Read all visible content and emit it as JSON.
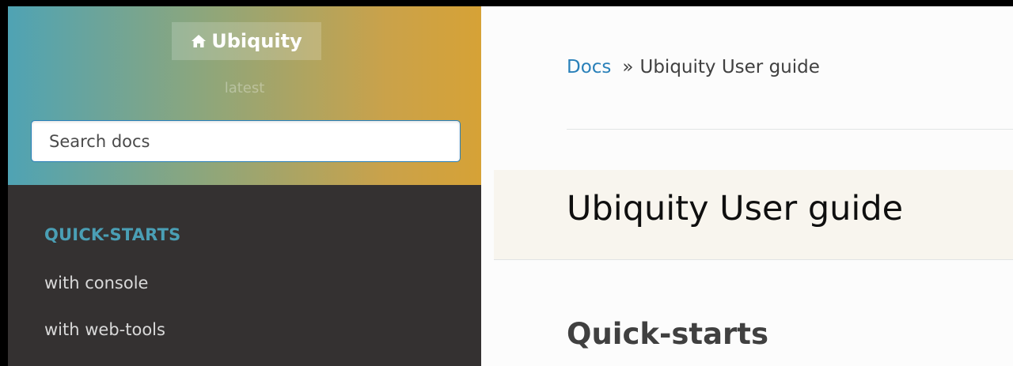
{
  "sidebar": {
    "brand": "Ubiquity",
    "version": "latest",
    "search": {
      "placeholder": "Search docs",
      "value": ""
    },
    "caption": "QUICK-STARTS",
    "items": [
      {
        "label": "with console"
      },
      {
        "label": "with web-tools"
      }
    ]
  },
  "breadcrumb": {
    "root": "Docs",
    "separator": "»",
    "current": "Ubiquity User guide"
  },
  "page": {
    "title": "Ubiquity User guide",
    "section_heading": "Quick-starts"
  },
  "colors": {
    "sidebar_bg": "#343131",
    "gradient_start": "#4fa3b4",
    "gradient_end": "#d6a236",
    "caption": "#4a9fb5",
    "link": "#2980b9",
    "title_band": "#f8f5ee"
  },
  "icons": {
    "brand": "home-icon"
  }
}
